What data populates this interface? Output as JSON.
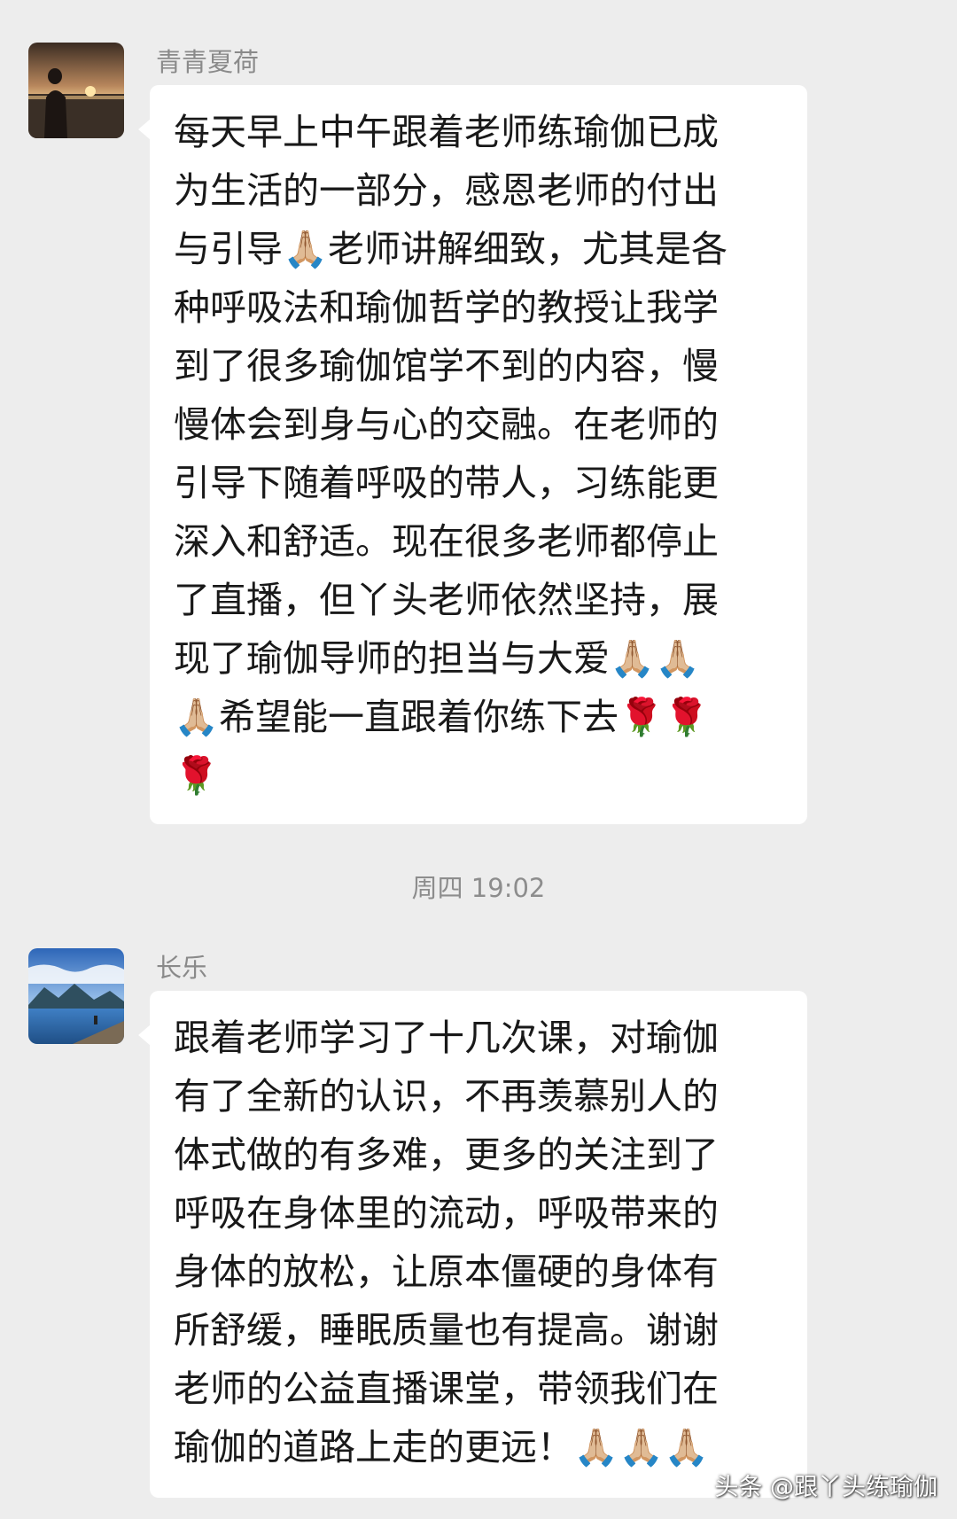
{
  "messages": [
    {
      "sender": "青青夏荷",
      "avatar_icon": "sunset-silhouette-avatar",
      "text": "每天早上中午跟着老师练瑜伽已成\n为生活的一部分，感恩老师的付出\n与引导🙏🏼老师讲解细致，尤其是各\n种呼吸法和瑜伽哲学的教授让我学\n到了很多瑜伽馆学不到的内容，慢\n慢体会到身与心的交融。在老师的\n引导下随着呼吸的带人，习练能更\n深入和舒适。现在很多老师都停止\n了直播，但丫头老师依然坚持，展\n现了瑜伽导师的担当与大爱🙏🏼🙏🏼\n🙏🏼希望能一直跟着你练下去🌹🌹\n🌹"
    },
    {
      "sender": "长乐",
      "avatar_icon": "lake-mountain-avatar",
      "text": "跟着老师学习了十几次课，对瑜伽\n有了全新的认识，不再羡慕别人的\n体式做的有多难，更多的关注到了\n呼吸在身体里的流动，呼吸带来的\n身体的放松，让原本僵硬的身体有\n所舒缓，睡眠质量也有提高。谢谢\n老师的公益直播课堂，带领我们在\n瑜伽的道路上走的更远！🙏🏼🙏🏼🙏🏼"
    }
  ],
  "timestamp": "周四 19:02",
  "watermark": "头条 @跟丫头练瑜伽",
  "colors": {
    "background": "#ededed",
    "bubble": "#ffffff",
    "sender_name": "#8a8a8a",
    "text": "#191919"
  }
}
